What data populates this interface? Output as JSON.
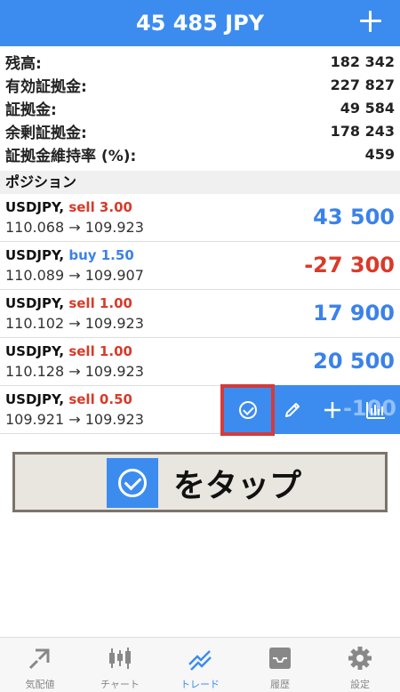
{
  "header": {
    "title": "45 485 JPY",
    "add_icon": "plus-icon"
  },
  "summary": [
    {
      "label": "残高:",
      "value": "182 342"
    },
    {
      "label": "有効証拠金:",
      "value": "227 827"
    },
    {
      "label": "証拠金:",
      "value": "49 584"
    },
    {
      "label": "余剰証拠金:",
      "value": "178 243"
    },
    {
      "label": "証拠金維持率 (%):",
      "value": "459"
    }
  ],
  "section_title": "ポジション",
  "positions": [
    {
      "symbol": "USDJPY,",
      "side": "sell 3.00",
      "side_type": "sell",
      "prices": "110.068 → 109.923",
      "profit": "43 500",
      "profit_sign": "positive"
    },
    {
      "symbol": "USDJPY,",
      "side": "buy 1.50",
      "side_type": "buy",
      "prices": "110.089 → 109.907",
      "profit": "-27 300",
      "profit_sign": "negative"
    },
    {
      "symbol": "USDJPY,",
      "side": "sell 1.00",
      "side_type": "sell",
      "prices": "110.102 → 109.923",
      "profit": "17 900",
      "profit_sign": "positive"
    },
    {
      "symbol": "USDJPY,",
      "side": "sell 1.00",
      "side_type": "sell",
      "prices": "110.128 → 109.923",
      "profit": "20 500",
      "profit_sign": "positive"
    },
    {
      "symbol": "USDJPY,",
      "side": "sell 0.50",
      "side_type": "sell",
      "prices": "109.921 → 109.923",
      "profit": "-100",
      "profit_sign": "negative"
    }
  ],
  "row_actions": [
    "close-position-icon",
    "edit-icon",
    "plus-icon",
    "chart-icon"
  ],
  "instruction": {
    "icon": "check-circle-icon",
    "text": "をタップ"
  },
  "tabs": [
    {
      "label": "気配値",
      "icon": "quotes-icon",
      "active": false
    },
    {
      "label": "チャート",
      "icon": "candles-icon",
      "active": false
    },
    {
      "label": "トレード",
      "icon": "trade-icon",
      "active": true
    },
    {
      "label": "履歴",
      "icon": "history-icon",
      "active": false
    },
    {
      "label": "設定",
      "icon": "gear-icon",
      "active": false
    }
  ],
  "colors": {
    "accent": "#3c8cf0",
    "sell": "#d93a28",
    "buy": "#3b82e8",
    "highlight": "#d23c3c"
  }
}
